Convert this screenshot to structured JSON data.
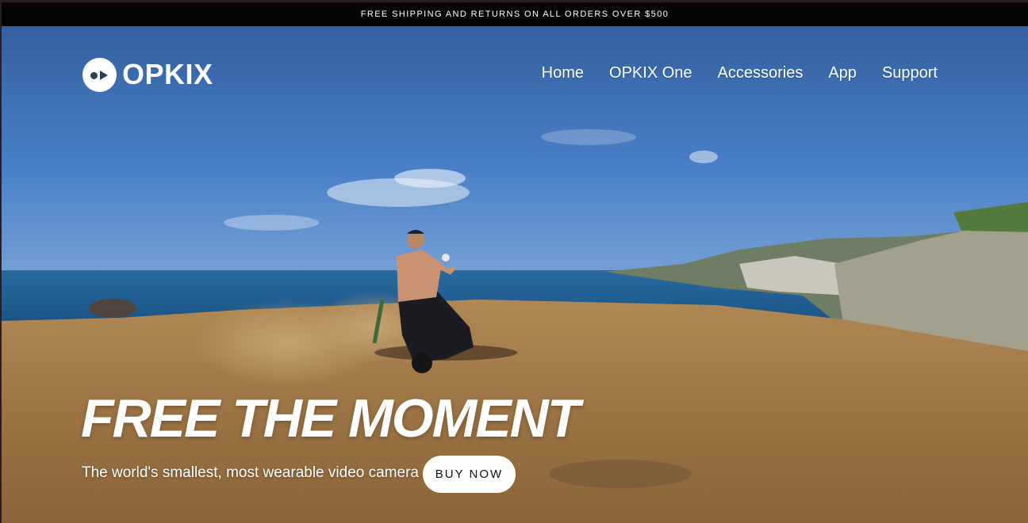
{
  "announcement": {
    "text": "FREE SHIPPING AND RETURNS ON ALL ORDERS OVER $500"
  },
  "brand": {
    "name": "OPKIX",
    "logo_icon": "play-eye-icon"
  },
  "nav": {
    "items": [
      {
        "label": "Home"
      },
      {
        "label": "OPKIX One"
      },
      {
        "label": "Accessories"
      },
      {
        "label": "App"
      },
      {
        "label": "Support"
      }
    ]
  },
  "hero": {
    "headline": "FREE THE MOMENT",
    "tagline": "The world's smallest, most wearable video camera",
    "cta_label": "BUY NOW"
  },
  "colors": {
    "announcement_bg": "#050505",
    "sky": "#3f74c2",
    "sea": "#1f5e91",
    "ground": "#a07a48",
    "cta_bg": "#ffffff"
  }
}
